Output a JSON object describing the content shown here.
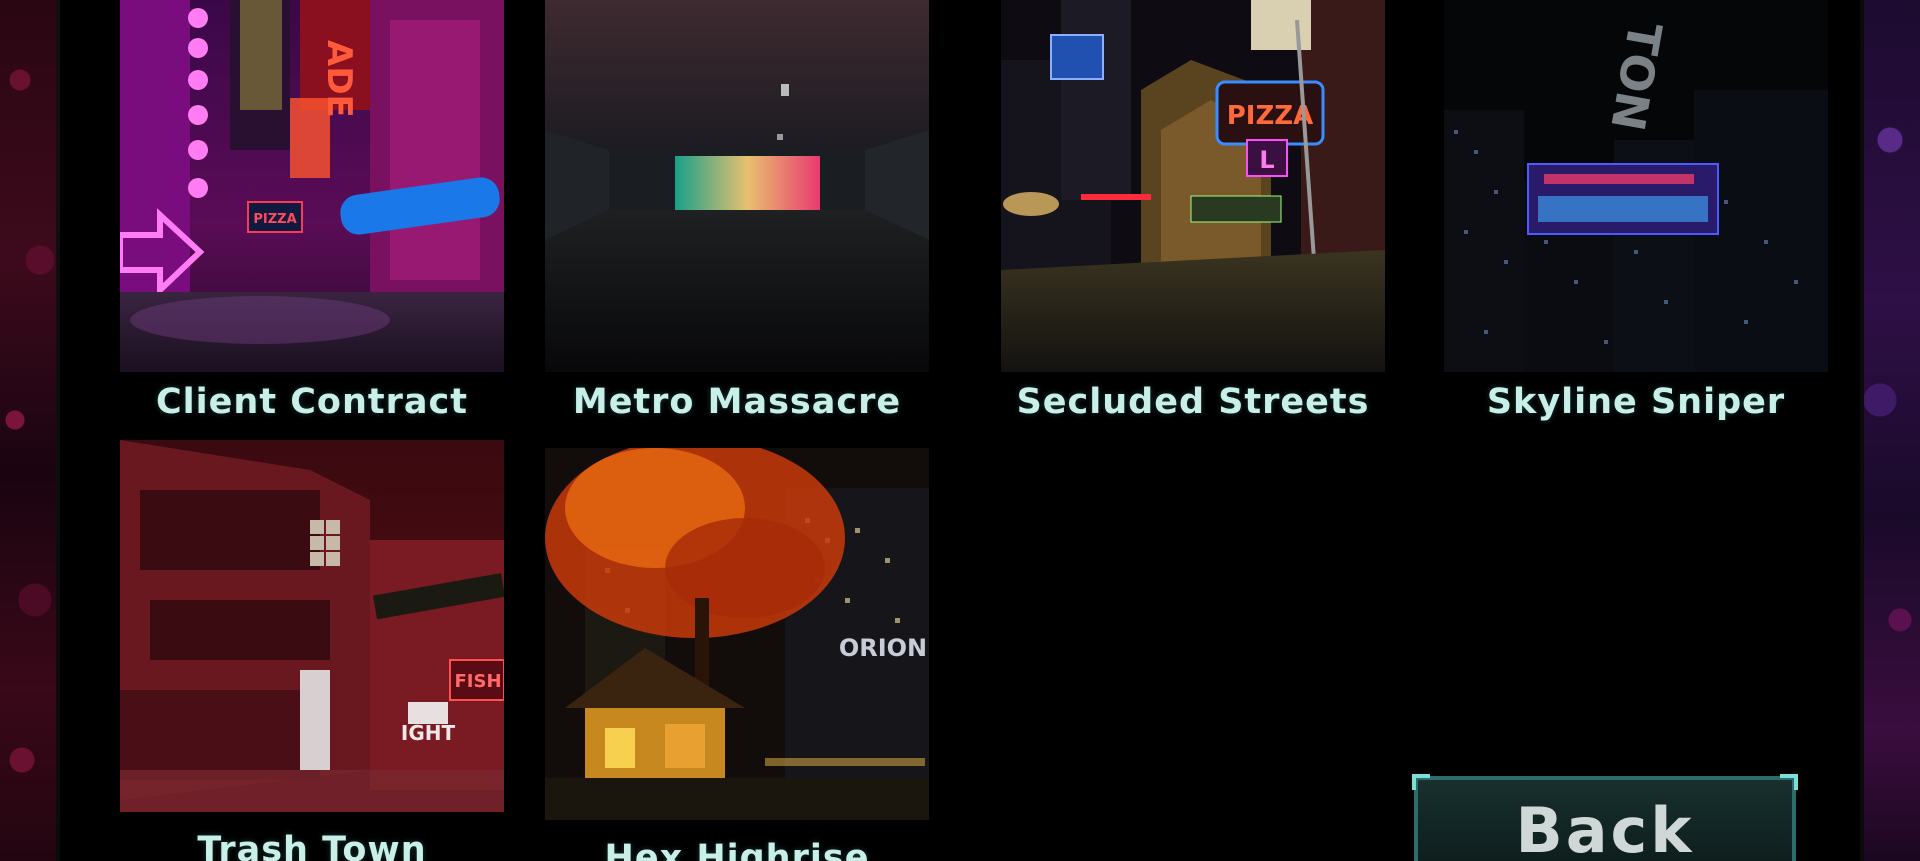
{
  "map_select": {
    "maps": [
      {
        "name": "Client Contract"
      },
      {
        "name": "Metro Massacre"
      },
      {
        "name": "Secluded Streets"
      },
      {
        "name": "Skyline Sniper"
      },
      {
        "name": "Trash Town"
      },
      {
        "name": "Hex Highrise"
      }
    ],
    "back_label": "Back"
  },
  "thumbnail_signs": {
    "client_contract": {
      "pizza": "PIZZA",
      "arcade": "ADE"
    },
    "secluded_streets": {
      "pizza": "PIZZA",
      "letter": "L"
    },
    "skyline_sniper": {
      "vertical": "TON"
    },
    "trash_town": {
      "fish": "FISH",
      "light": "IGHT"
    },
    "hex_highrise": {
      "orion": "ORION"
    }
  },
  "colors": {
    "label_text": "#c8efe8",
    "button_border": "#2c6f6a",
    "button_accent": "#7ae0d8",
    "button_text": "#cfd8d6"
  }
}
